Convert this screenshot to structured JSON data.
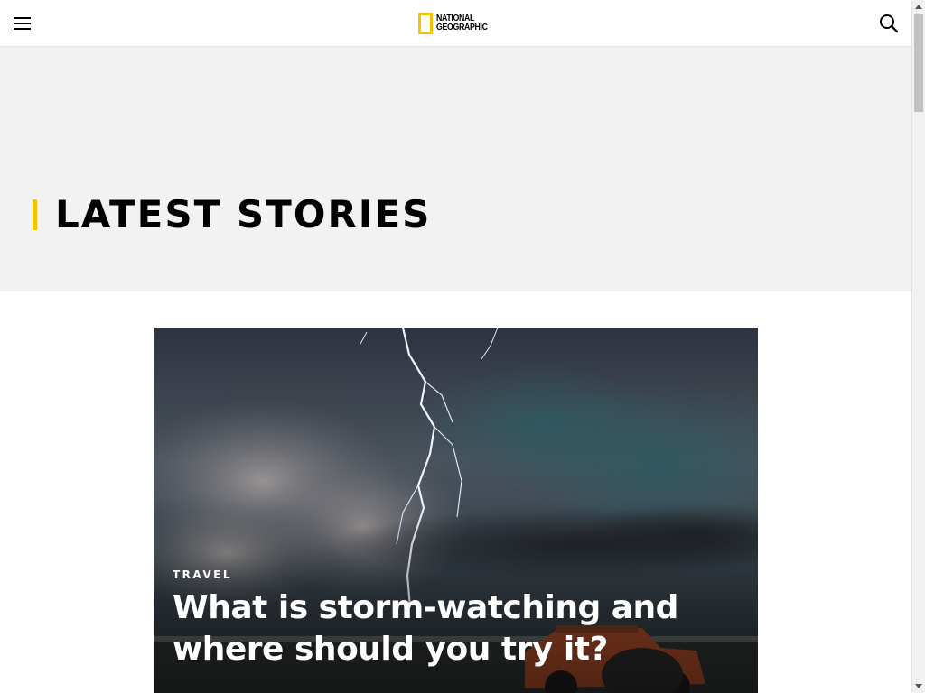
{
  "header": {
    "logo_line1": "NATIONAL",
    "logo_line2": "GEOGRAPHIC",
    "menu_icon": "hamburger-menu-icon",
    "search_icon": "search-icon",
    "brand_color": "#f4c400"
  },
  "hero": {
    "title": "LATEST STORIES"
  },
  "story": {
    "category": "TRAVEL",
    "title": "What is storm-watching and where should you try it?"
  }
}
